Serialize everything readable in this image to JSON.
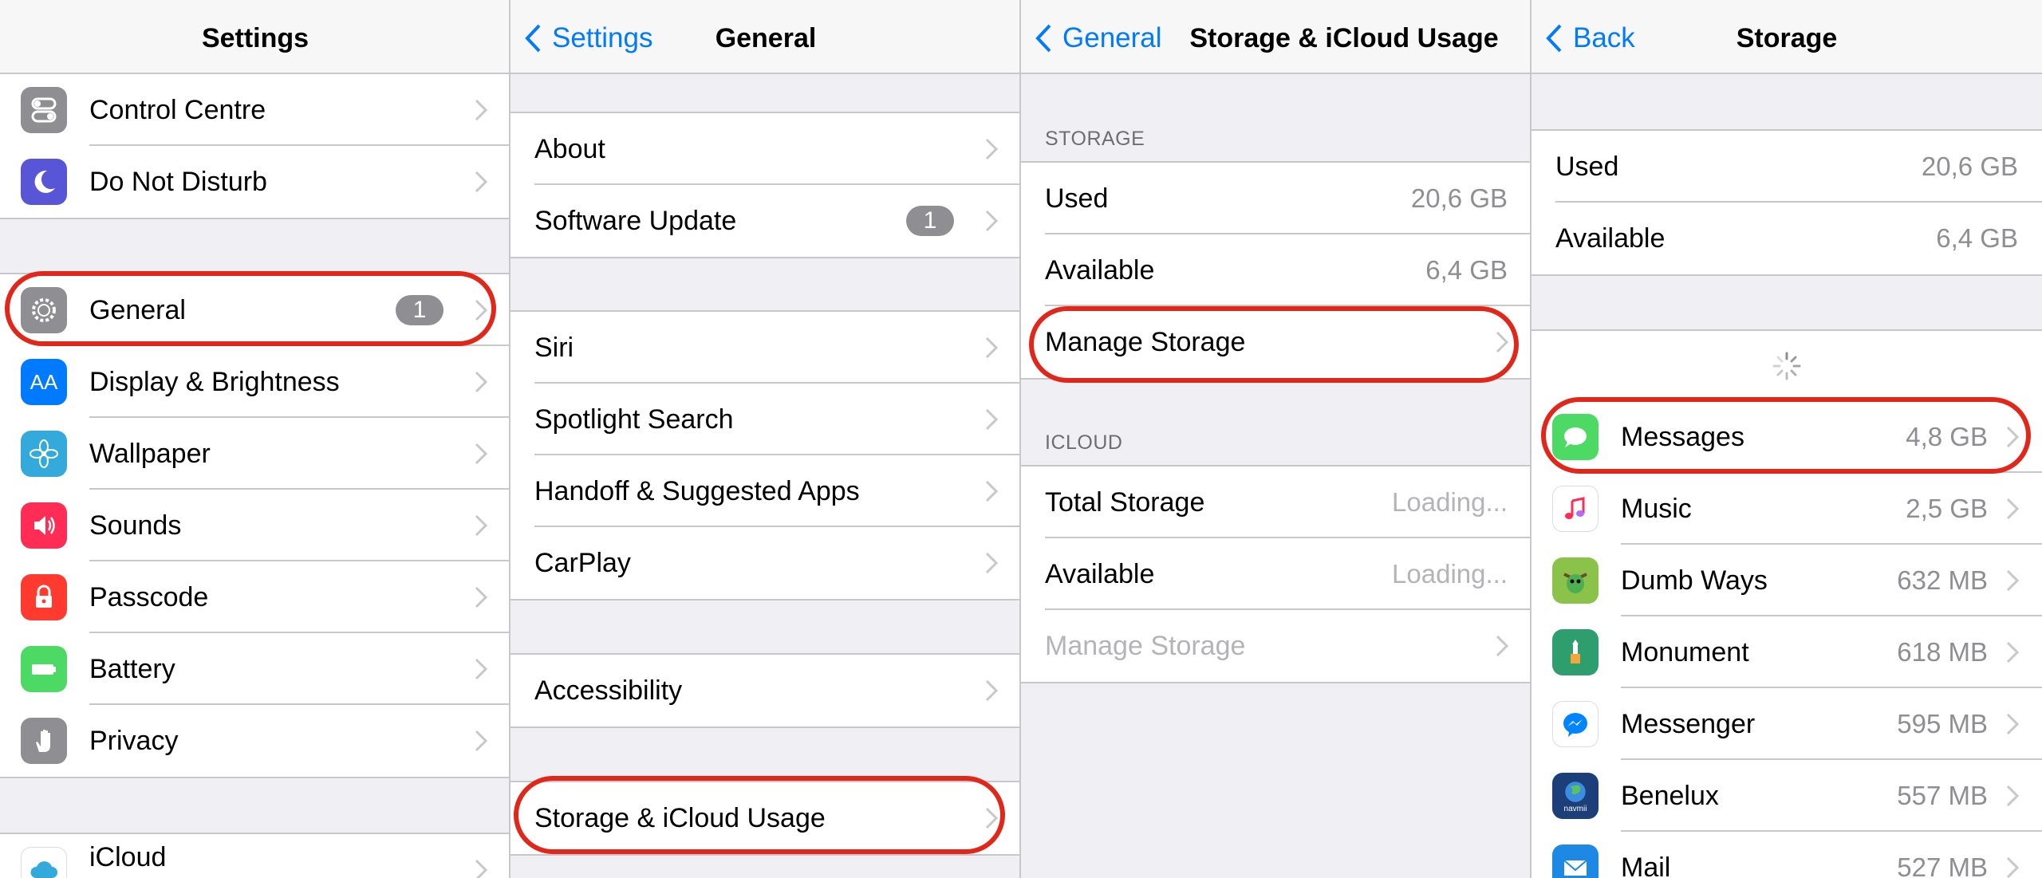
{
  "panel1": {
    "title": "Settings",
    "group_top": [
      {
        "label": "Control Centre",
        "icon": "control-centre-icon",
        "color": "#8e8e93"
      },
      {
        "label": "Do Not Disturb",
        "icon": "moon-icon",
        "color": "#5856d6"
      }
    ],
    "group_main": [
      {
        "label": "General",
        "icon": "gear-icon",
        "color": "#8e8e93",
        "badge": "1"
      },
      {
        "label": "Display & Brightness",
        "icon": "text-size-icon",
        "color": "#007aff",
        "icon_text": "AA"
      },
      {
        "label": "Wallpaper",
        "icon": "flower-icon",
        "color": "#34aadc"
      },
      {
        "label": "Sounds",
        "icon": "speaker-icon",
        "color": "#ff2d55"
      },
      {
        "label": "Passcode",
        "icon": "lock-icon",
        "color": "#ff3b30"
      },
      {
        "label": "Battery",
        "icon": "battery-icon",
        "color": "#4cd964"
      },
      {
        "label": "Privacy",
        "icon": "hand-icon",
        "color": "#8e8e93"
      }
    ],
    "group_bottom": [
      {
        "label": "iCloud",
        "icon": "cloud-icon",
        "color": "#ffffff"
      }
    ]
  },
  "panel2": {
    "back": "Settings",
    "title": "General",
    "group1": [
      {
        "label": "About"
      },
      {
        "label": "Software Update",
        "badge": "1"
      }
    ],
    "group2": [
      {
        "label": "Siri"
      },
      {
        "label": "Spotlight Search"
      },
      {
        "label": "Handoff & Suggested Apps"
      },
      {
        "label": "CarPlay"
      }
    ],
    "group3": [
      {
        "label": "Accessibility"
      }
    ],
    "group4": [
      {
        "label": "Storage & iCloud Usage"
      }
    ]
  },
  "panel3": {
    "back": "General",
    "title": "Storage & iCloud Usage",
    "storage_header": "STORAGE",
    "storage": [
      {
        "label": "Used",
        "value": "20,6 GB"
      },
      {
        "label": "Available",
        "value": "6,4 GB"
      },
      {
        "label": "Manage Storage"
      }
    ],
    "icloud_header": "ICLOUD",
    "icloud": [
      {
        "label": "Total Storage",
        "value": "Loading..."
      },
      {
        "label": "Available",
        "value": "Loading..."
      },
      {
        "label": "Manage Storage"
      }
    ]
  },
  "panel4": {
    "back": "Back",
    "title": "Storage",
    "summary": [
      {
        "label": "Used",
        "value": "20,6 GB"
      },
      {
        "label": "Available",
        "value": "6,4 GB"
      }
    ],
    "apps": [
      {
        "label": "Messages",
        "value": "4,8 GB",
        "icon": "messages-icon",
        "color": "#4cd964"
      },
      {
        "label": "Music",
        "value": "2,5 GB",
        "icon": "music-note-icon",
        "color": "#ffffff"
      },
      {
        "label": "Dumb Ways",
        "value": "632 MB",
        "icon": "dumb-ways-icon",
        "color": "#8bc34a"
      },
      {
        "label": "Monument",
        "value": "618 MB",
        "icon": "monument-icon",
        "color": "#2e9e6e"
      },
      {
        "label": "Messenger",
        "value": "595 MB",
        "icon": "messenger-icon",
        "color": "#ffffff"
      },
      {
        "label": "Benelux",
        "value": "557 MB",
        "icon": "globe-icon",
        "color": "#1c3f7a",
        "icon_caption": "navmii"
      },
      {
        "label": "Mail",
        "value": "527 MB",
        "icon": "mail-icon",
        "color": "#1e88e5"
      }
    ]
  },
  "colors": {
    "accent": "#007aff",
    "highlight": "#e0271a",
    "badge": "#8e8e93"
  }
}
